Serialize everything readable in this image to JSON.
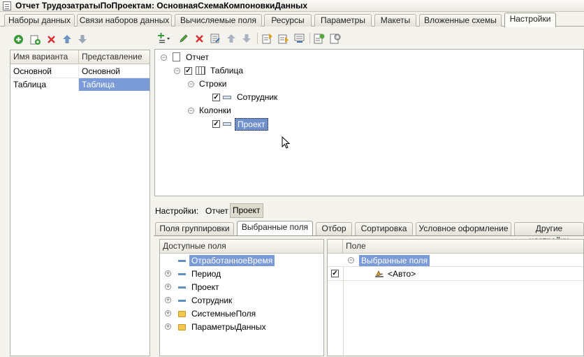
{
  "window": {
    "title": "Отчет ТрудозатратыПоПроектам: ОсновнаяСхемаКомпоновкиДанных"
  },
  "main_tabs": [
    {
      "label": "Наборы данных"
    },
    {
      "label": "Связи наборов данных"
    },
    {
      "label": "Вычисляемые поля"
    },
    {
      "label": "Ресурсы"
    },
    {
      "label": "Параметры"
    },
    {
      "label": "Макеты"
    },
    {
      "label": "Вложенные схемы"
    },
    {
      "label": "Настройки"
    }
  ],
  "variants": {
    "headers": [
      "Имя варианта",
      "Представление"
    ],
    "rows": [
      {
        "name": "Основной",
        "presentation": "Основной"
      },
      {
        "name": "Таблица",
        "presentation": "Таблица"
      }
    ]
  },
  "structure": {
    "root": "Отчет",
    "table": "Таблица",
    "rows_label": "Строки",
    "row_field": "Сотрудник",
    "columns_label": "Колонки",
    "column_field": "Проект"
  },
  "settings_bar": {
    "label": "Настройки:",
    "items": [
      "Отчет",
      "Проект"
    ]
  },
  "sub_tabs": [
    {
      "label": "Поля группировки"
    },
    {
      "label": "Выбранные поля"
    },
    {
      "label": "Отбор"
    },
    {
      "label": "Сортировка"
    },
    {
      "label": "Условное оформление"
    },
    {
      "label": "Другие настройки"
    }
  ],
  "available_fields": {
    "header": "Доступные поля",
    "items": [
      {
        "label": "ОтработанноеВремя"
      },
      {
        "label": "Период"
      },
      {
        "label": "Проект"
      },
      {
        "label": "Сотрудник"
      },
      {
        "label": "СистемныеПоля"
      },
      {
        "label": "ПараметрыДанных"
      }
    ]
  },
  "selected_fields": {
    "header": "Поле",
    "group": "Выбранные поля",
    "auto": "<Авто>"
  },
  "colors": {
    "selection": "#7a9bd8",
    "accent_green": "#3a9a3a",
    "delete_red": "#d23030"
  }
}
